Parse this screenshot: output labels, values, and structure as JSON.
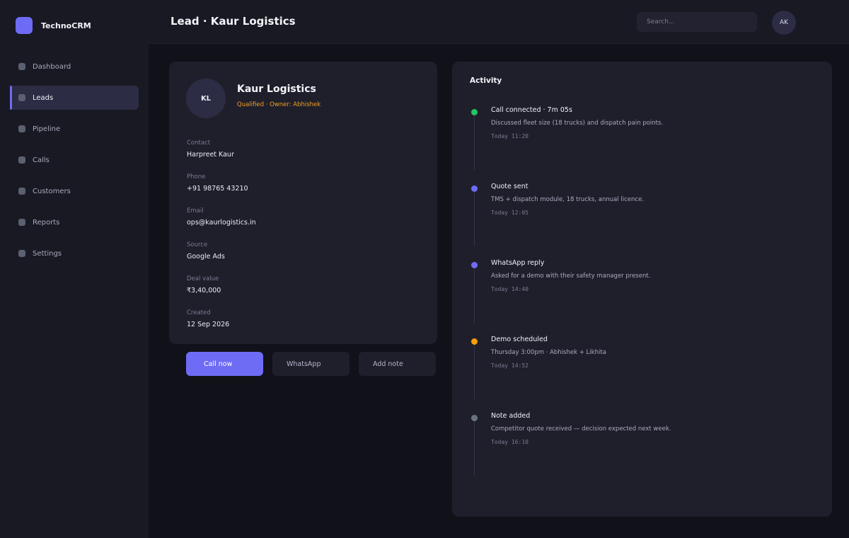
{
  "app": {
    "name": "TechnoCRM"
  },
  "sidebar": {
    "items": [
      {
        "label": "Dashboard"
      },
      {
        "label": "Leads"
      },
      {
        "label": "Pipeline"
      },
      {
        "label": "Calls"
      },
      {
        "label": "Customers"
      },
      {
        "label": "Reports"
      },
      {
        "label": "Settings"
      }
    ],
    "active": "Leads"
  },
  "header": {
    "title": "Lead · Kaur Logistics",
    "search_placeholder": "Search...",
    "user_initials": "AK"
  },
  "lead": {
    "initials": "KL",
    "name": "Kaur Logistics",
    "meta": "Qualified · Owner: Abhishek",
    "fields": [
      {
        "label": "Contact",
        "value": "Harpreet Kaur"
      },
      {
        "label": "Phone",
        "value": "+91 98765 43210"
      },
      {
        "label": "Email",
        "value": "ops@kaurlogistics.in"
      },
      {
        "label": "Source",
        "value": "Google Ads"
      },
      {
        "label": "Deal value",
        "value": "₹3,40,000"
      },
      {
        "label": "Created",
        "value": "12 Sep 2026"
      }
    ]
  },
  "actions": {
    "call_label": "Call now",
    "whatsapp_label": "WhatsApp",
    "note_label": "Add note"
  },
  "activity": {
    "title": "Activity",
    "items": [
      {
        "title": "Call connected · 7m 05s",
        "desc": "Discussed fleet size (18 trucks) and dispatch pain points.",
        "time": "Today 11:20",
        "color": "#22c55e"
      },
      {
        "title": "Quote sent",
        "desc": "TMS + dispatch module, 18 trucks, annual licence.",
        "time": "Today 12:05",
        "color": "#6e6cf5"
      },
      {
        "title": "WhatsApp reply",
        "desc": "Asked for a demo with their safety manager present.",
        "time": "Today 14:40",
        "color": "#6e6cf5"
      },
      {
        "title": "Demo scheduled",
        "desc": "Thursday 3:00pm · Abhishek + Likhita",
        "time": "Today 14:52",
        "color": "#f59e0b"
      },
      {
        "title": "Note added",
        "desc": "Competitor quote received — decision expected next week.",
        "time": "Today 16:10",
        "color": "#6b7280"
      }
    ]
  },
  "colors": {
    "accent": "#6e6cf5",
    "owner_meta": "#f0a023"
  }
}
